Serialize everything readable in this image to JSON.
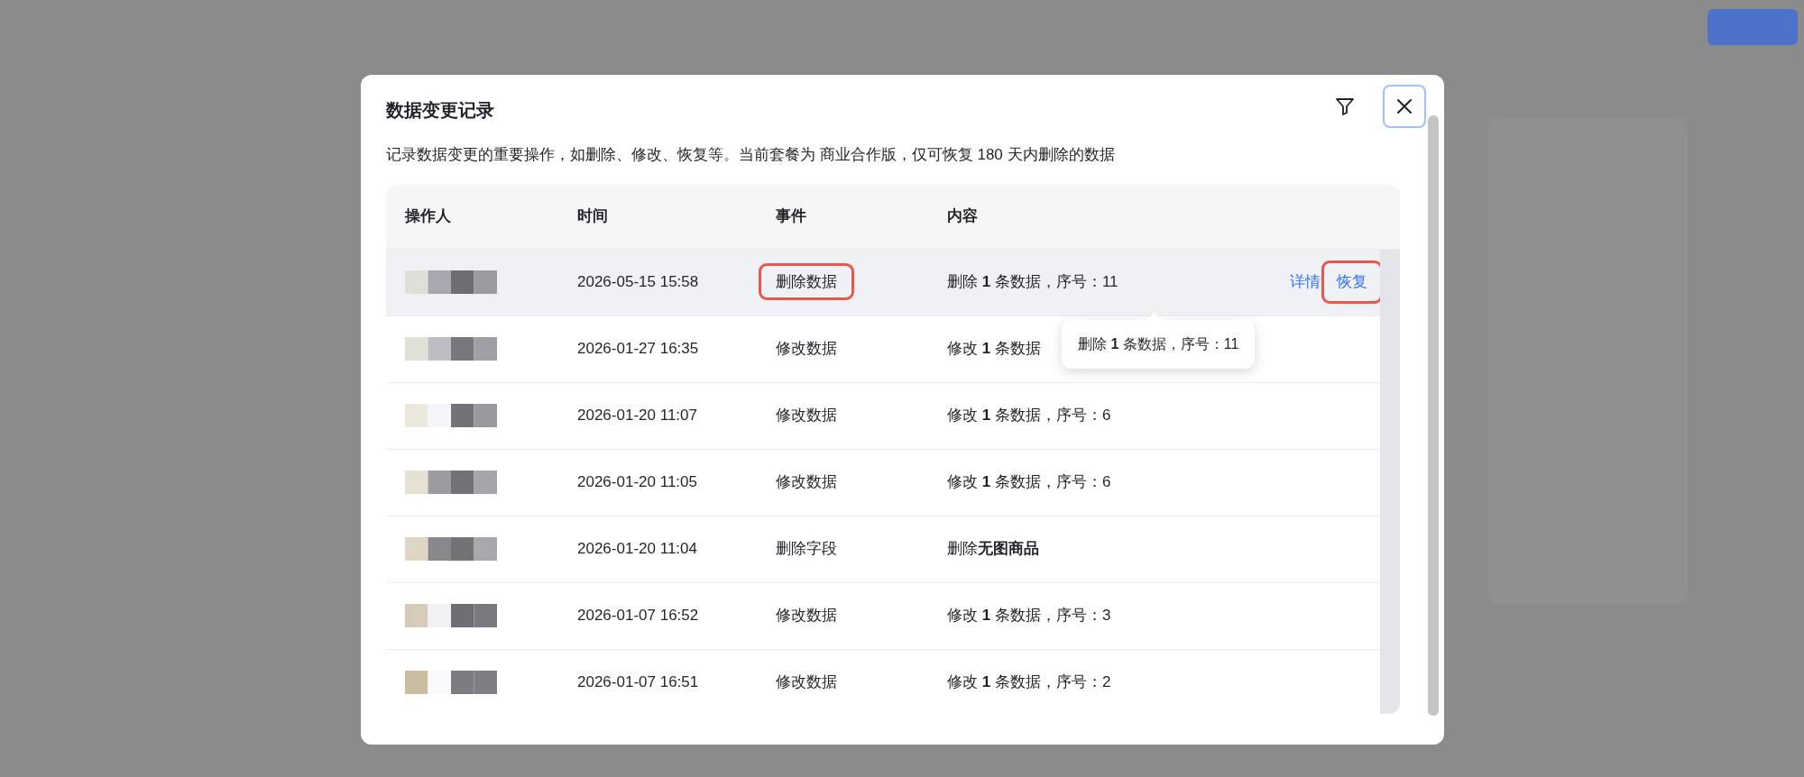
{
  "dialog": {
    "title": "数据变更记录",
    "description": "记录数据变更的重要操作，如删除、修改、恢复等。当前套餐为 商业合作版，仅可恢复 180 天内删除的数据",
    "columns": [
      "操作人",
      "时间",
      "事件",
      "内容"
    ],
    "rows": [
      {
        "time": "2026-05-15 15:58",
        "event": "删除数据",
        "event_highlighted": true,
        "content": "删除 **1** 条数据，序号：11",
        "hovered": true,
        "actions": [
          {
            "label": "详情",
            "highlighted": false
          },
          {
            "label": "恢复",
            "highlighted": true
          }
        ]
      },
      {
        "time": "2026-01-27 16:35",
        "event": "修改数据",
        "event_highlighted": false,
        "content": "修改 **1** 条数据",
        "hovered": false
      },
      {
        "time": "2026-01-20 11:07",
        "event": "修改数据",
        "event_highlighted": false,
        "content": "修改 **1** 条数据，序号：6",
        "hovered": false
      },
      {
        "time": "2026-01-20 11:05",
        "event": "修改数据",
        "event_highlighted": false,
        "content": "修改 **1** 条数据，序号：6",
        "hovered": false
      },
      {
        "time": "2026-01-20 11:04",
        "event": "删除字段",
        "event_highlighted": false,
        "content": "删除**无图商品**",
        "hovered": false
      },
      {
        "time": "2026-01-07 16:52",
        "event": "修改数据",
        "event_highlighted": false,
        "content": "修改 **1** 条数据，序号：3",
        "hovered": false
      },
      {
        "time": "2026-01-07 16:51",
        "event": "修改数据",
        "event_highlighted": false,
        "content": "修改 **1** 条数据，序号：2",
        "hovered": false
      }
    ],
    "tooltip": {
      "text": "删除 **1** 条数据，序号：11"
    }
  }
}
